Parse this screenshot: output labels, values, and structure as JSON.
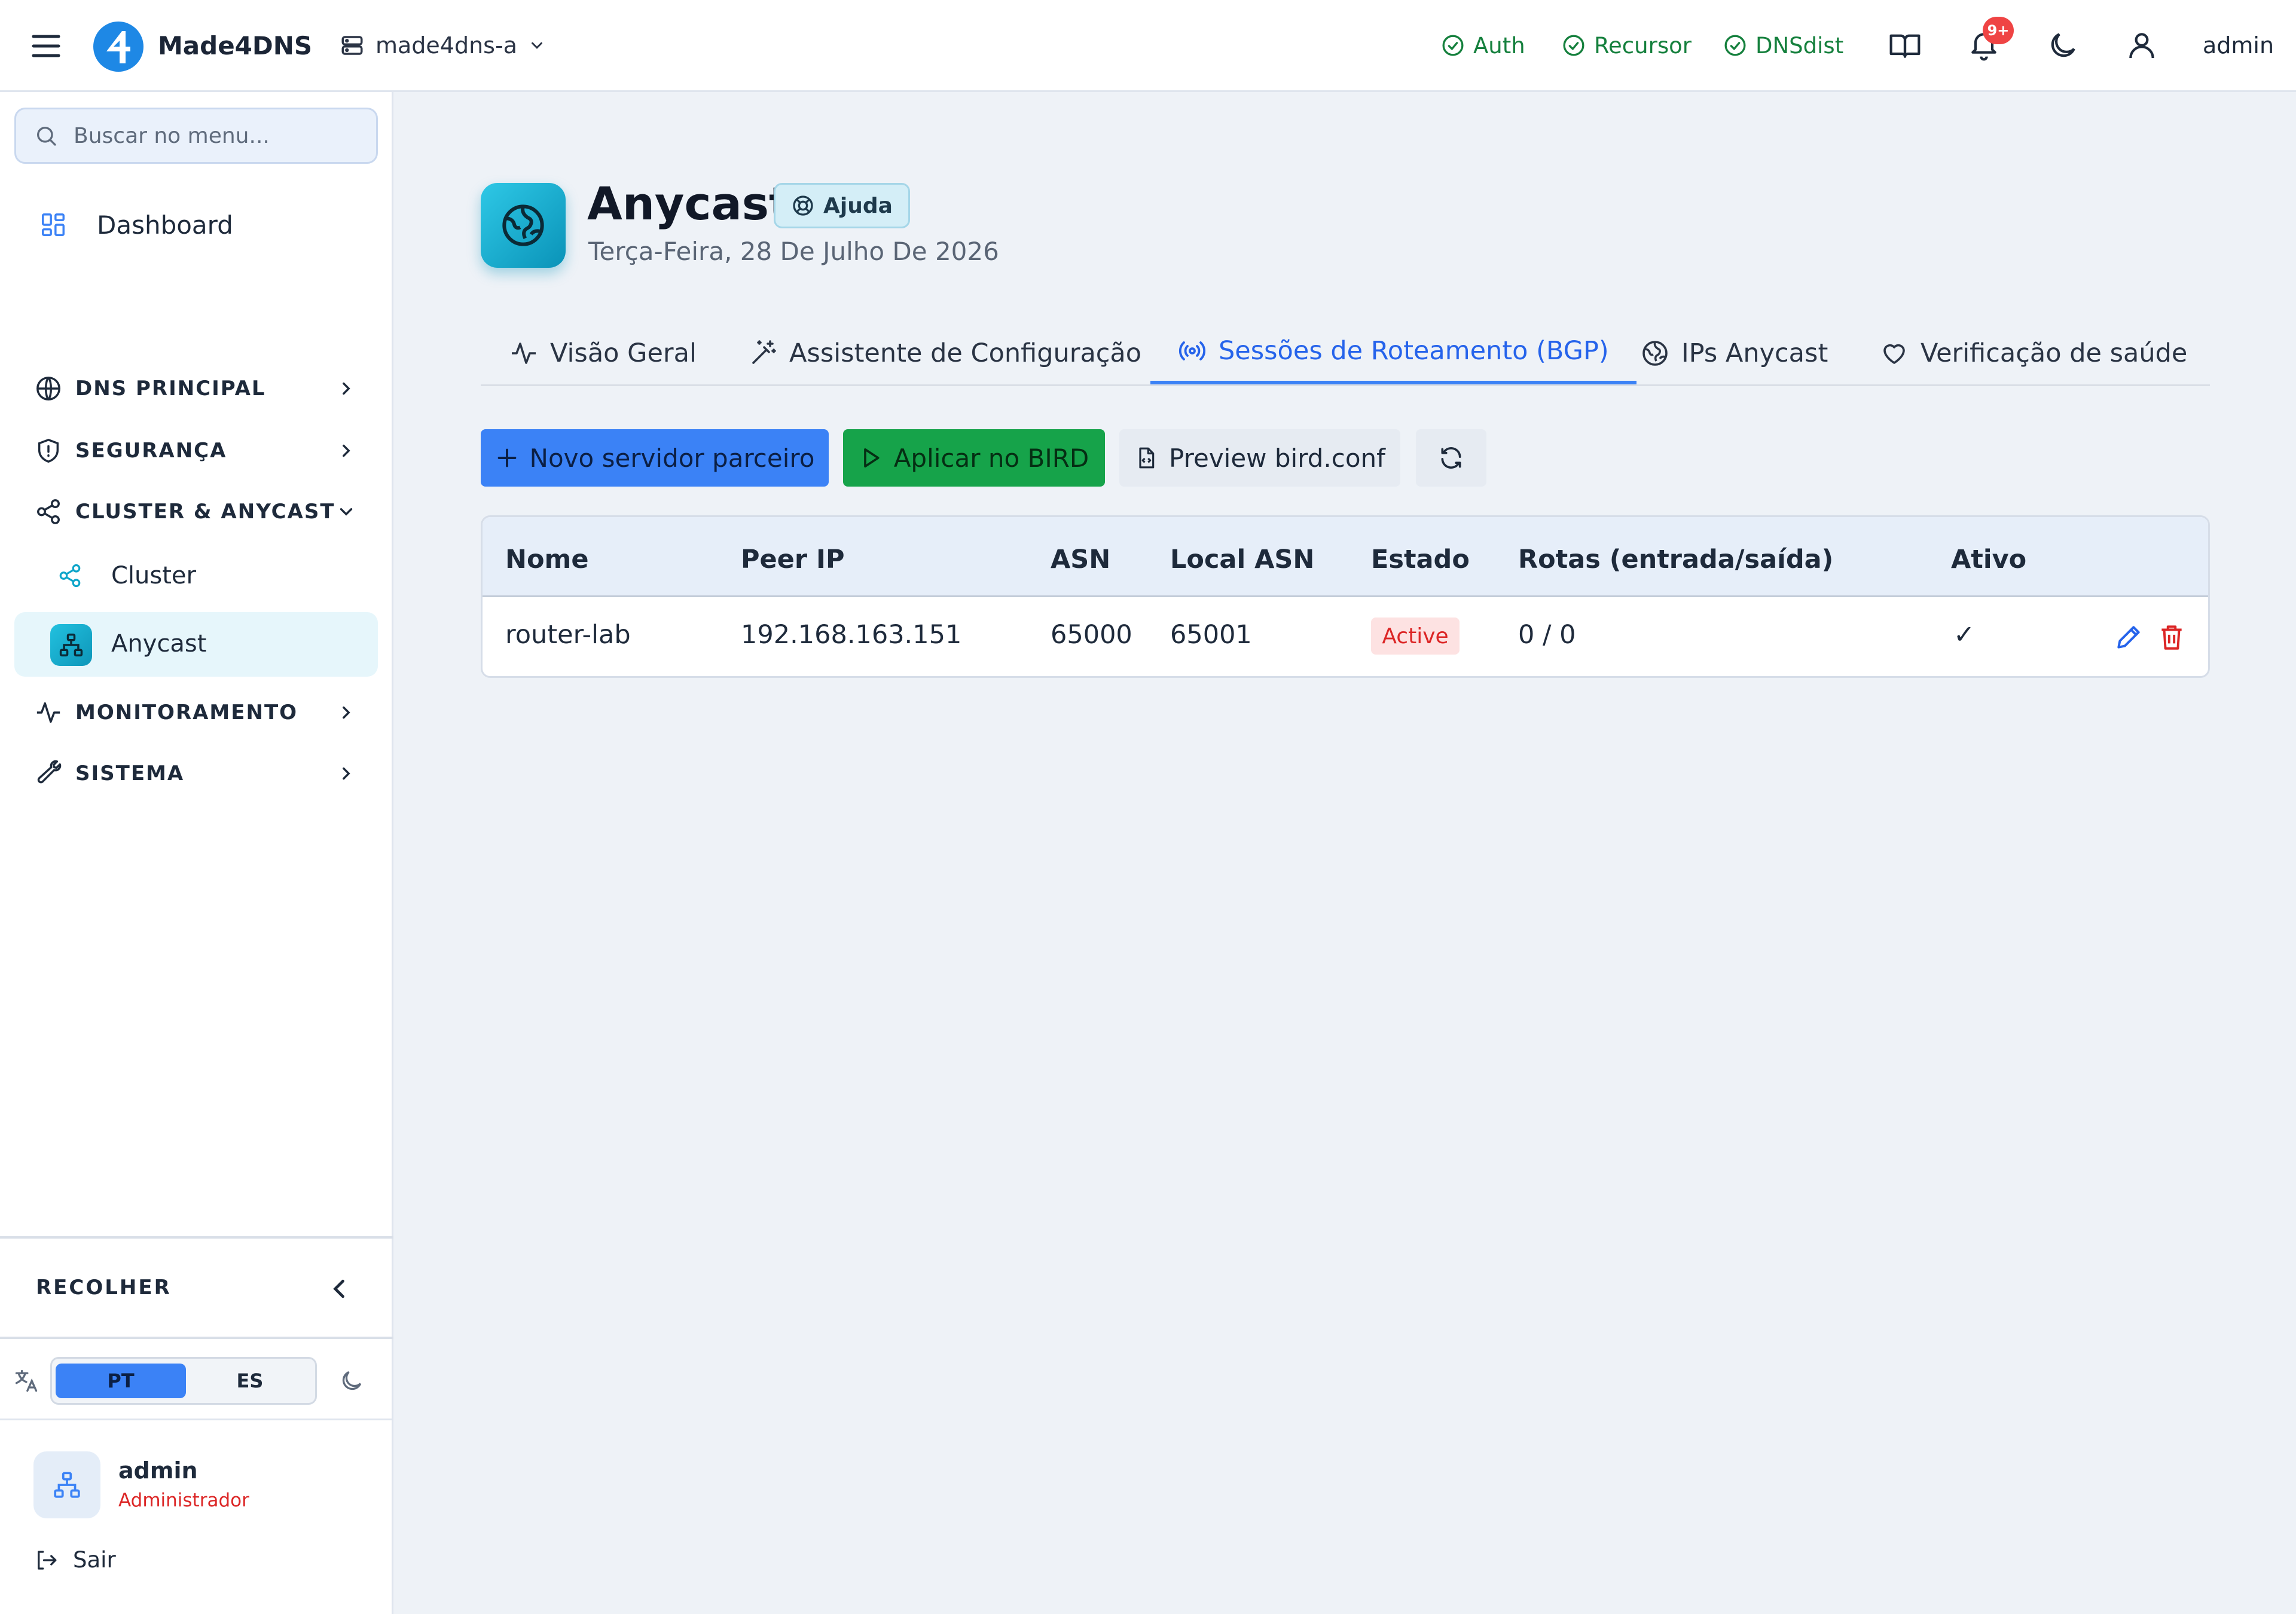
{
  "app": {
    "brand": "Made4DNS",
    "server": "made4dns-a"
  },
  "header": {
    "services": [
      {
        "label": "Auth",
        "status": "ok"
      },
      {
        "label": "Recursor",
        "status": "ok"
      },
      {
        "label": "DNSdist",
        "status": "ok"
      }
    ],
    "notifications_badge": "9+",
    "user": "admin"
  },
  "sidebar": {
    "search_placeholder": "Buscar no menu...",
    "dashboard": "Dashboard",
    "groups": {
      "dns": "DNS PRINCIPAL",
      "security": "SEGURANÇA",
      "cluster": "CLUSTER & ANYCAST",
      "monitoring": "MONITORAMENTO",
      "system": "SISTEMA"
    },
    "cluster_items": {
      "cluster": "Cluster",
      "anycast": "Anycast"
    },
    "collapse": "RECOLHER",
    "languages": {
      "pt": "PT",
      "es": "ES",
      "selected": "PT"
    },
    "profile": {
      "name": "admin",
      "role": "Administrador"
    },
    "logout": "Sair"
  },
  "page": {
    "title": "Anycast",
    "help": "Ajuda",
    "date": "Terça-Feira, 28 De Julho De 2026",
    "tabs": [
      {
        "label": "Visão Geral"
      },
      {
        "label": "Assistente de Configuração"
      },
      {
        "label": "Sessões de Roteamento (BGP)",
        "active": true
      },
      {
        "label": "IPs Anycast"
      },
      {
        "label": "Verificação de saúde"
      }
    ],
    "actions": {
      "new_peer": "Novo servidor parceiro",
      "apply": "Aplicar no BIRD",
      "preview": "Preview bird.conf"
    },
    "table": {
      "headers": [
        "Nome",
        "Peer IP",
        "ASN",
        "Local ASN",
        "Estado",
        "Rotas (entrada/saída)",
        "Ativo"
      ],
      "rows": [
        {
          "name": "router-lab",
          "peer_ip": "192.168.163.151",
          "asn": "65000",
          "local_asn": "65001",
          "state": "Active",
          "routes": "0 / 0",
          "enabled": "✓"
        }
      ]
    }
  },
  "colors": {
    "accent": "#3b82f6",
    "success": "#16a34a",
    "danger": "#dc2626",
    "teal": "#0e96b9"
  }
}
